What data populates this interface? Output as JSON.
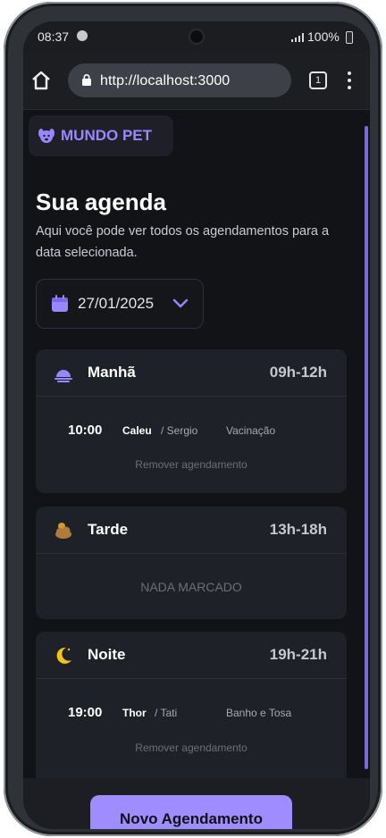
{
  "status_bar": {
    "time": "08:37",
    "battery": "100%"
  },
  "browser": {
    "url": "http://localhost:3000",
    "tab_count": "1"
  },
  "brand": {
    "name": "MUNDO PET"
  },
  "header": {
    "title": "Sua agenda",
    "description": "Aqui você pode ver todos os agendamentos para a data selecionada."
  },
  "date_picker": {
    "value": "27/01/2025"
  },
  "periods": [
    {
      "name": "Manhã",
      "range": "09h-12h",
      "icon": "sunrise-icon",
      "appointments": [
        {
          "time": "10:00",
          "pet": "Caleu",
          "tutor": "/ Sergio",
          "service": "Vacinação",
          "remove_label": "Remover agendamento"
        }
      ]
    },
    {
      "name": "Tarde",
      "range": "13h-18h",
      "icon": "cloud-sun-icon",
      "empty_label": "NADA MARCADO",
      "appointments": []
    },
    {
      "name": "Noite",
      "range": "19h-21h",
      "icon": "moon-icon",
      "appointments": [
        {
          "time": "19:00",
          "pet": "Thor",
          "tutor": "/ Tati",
          "service": "Banho e Tosa",
          "remove_label": "Remover agendamento"
        }
      ]
    }
  ],
  "footer": {
    "new_button_label": "Novo Agendamento"
  },
  "colors": {
    "accent": "#9f8cff",
    "background": "#121317",
    "card": "#1f2128"
  }
}
